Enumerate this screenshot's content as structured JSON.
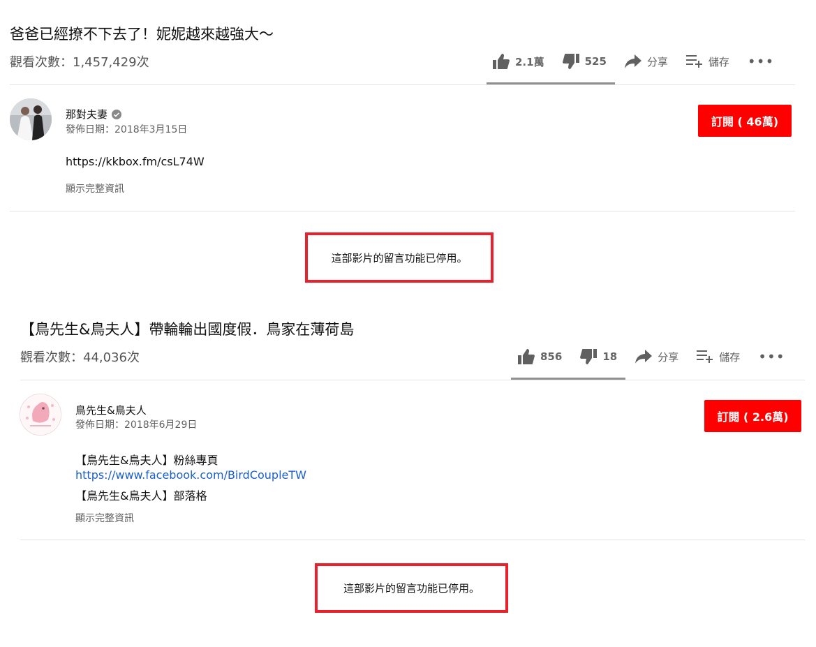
{
  "videos": [
    {
      "title": "爸爸已經撩不下去了！妮妮越來越強大～",
      "views": "觀看次數：1,457,429次",
      "likes": "2.1萬",
      "dislikes": "525",
      "share": "分享",
      "save": "儲存",
      "more": "•••",
      "channel": "那對夫妻",
      "verified": true,
      "published": "發佈日期：2018年3月15日",
      "subscribe": "訂閱 ( 46萬)",
      "description": [
        "https://kkbox.fm/csL74W"
      ],
      "show_more": "顯示完整資訊",
      "comments_disabled": "這部影片的留言功能已停用。"
    },
    {
      "title": "【鳥先生&鳥夫人】帶輪輪出國度假．鳥家在薄荷島",
      "views": "觀看次數：44,036次",
      "likes": "856",
      "dislikes": "18",
      "share": "分享",
      "save": "儲存",
      "more": "•••",
      "channel": "鳥先生&鳥夫人",
      "published": "發佈日期：2018年6月29日",
      "subscribe": "訂閱 ( 2.6萬)",
      "description_line1": "【鳥先生&鳥夫人】粉絲專頁",
      "description_link": "https://www.facebook.com/BirdCoupleTW",
      "description_line3": "【鳥先生&鳥夫人】部落格",
      "show_more": "顯示完整資訊",
      "comments_disabled": "這部影片的留言功能已停用。"
    }
  ],
  "colors": {
    "subscribe_red": "#ff0000",
    "highlight_red": "#e8212c",
    "link_blue": "#1a5ecc"
  }
}
